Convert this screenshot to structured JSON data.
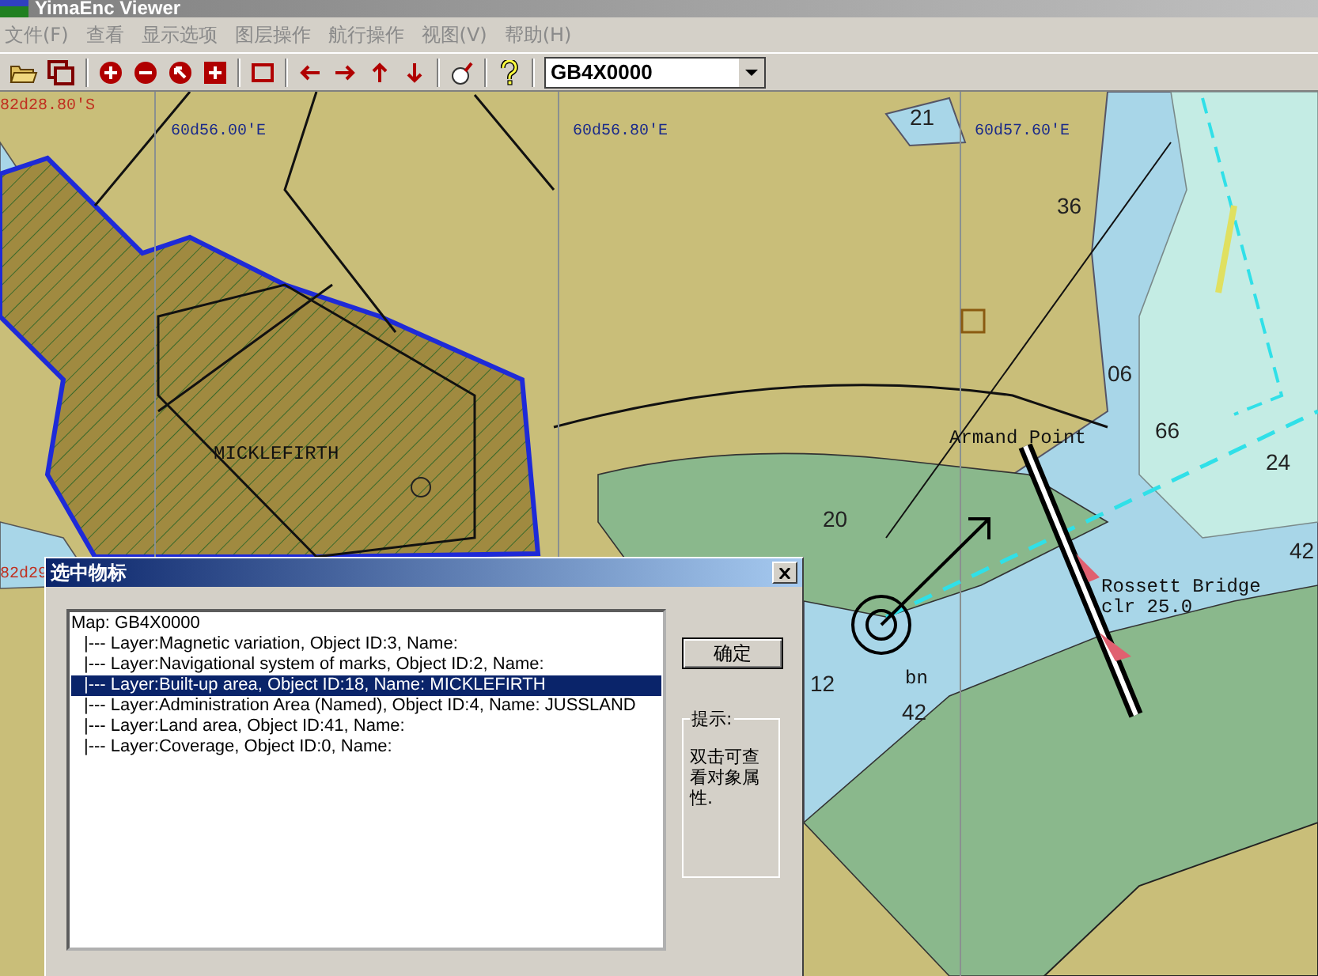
{
  "window": {
    "title": "YimaEnc Viewer"
  },
  "menu": [
    "文件(F)",
    "查看",
    "显示选项",
    "图层操作",
    "航行操作",
    "视图(V)",
    "帮助(H)"
  ],
  "toolbar": {
    "chart_select": {
      "value": "GB4X0000"
    }
  },
  "map": {
    "grid_labels": [
      "82d28.80'S",
      "60d56.00'E",
      "60d56.80'E",
      "60d57.60'E",
      "82d29"
    ],
    "labels": [
      "MICKLEFIRTH",
      "Armand Point",
      "Rossett Bridge",
      "clr 25.0",
      "bn"
    ],
    "soundings": [
      "21",
      "36",
      "06",
      "66",
      "24",
      "42",
      "20",
      "12",
      "42"
    ]
  },
  "dialog": {
    "title": "选中物标",
    "tree": {
      "text": "Map: GB4X0000",
      "children": [
        {
          "text": "|---  Layer:Magnetic variation, Object ID:3, Name:",
          "selected": false
        },
        {
          "text": "|---  Layer:Navigational system of marks, Object ID:2, Name:",
          "selected": false
        },
        {
          "text": "|---  Layer:Built-up area, Object ID:18, Name: MICKLEFIRTH",
          "selected": true
        },
        {
          "text": "|---  Layer:Administration Area (Named), Object ID:4, Name: JUSSLAND",
          "selected": false
        },
        {
          "text": "|---  Layer:Land area, Object ID:41, Name:",
          "selected": false
        },
        {
          "text": "|---  Layer:Coverage, Object ID:0, Name:",
          "selected": false
        }
      ]
    },
    "ok_button": "确定",
    "hint": {
      "title": "提示:",
      "text": "双击可查看对象属性."
    }
  }
}
